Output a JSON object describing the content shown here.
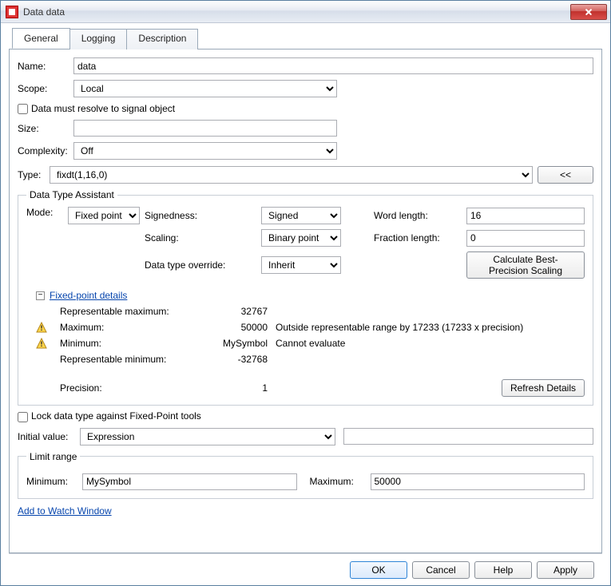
{
  "window": {
    "title": "Data data"
  },
  "tabs": {
    "t0": "General",
    "t1": "Logging",
    "t2": "Description"
  },
  "labels": {
    "name": "Name:",
    "scope": "Scope:",
    "resolve": "Data must resolve to signal object",
    "size": "Size:",
    "complexity": "Complexity:",
    "type": "Type:",
    "collapse": "<<",
    "dta": "Data Type Assistant",
    "mode": "Mode:",
    "signed": "Signedness:",
    "scaling": "Scaling:",
    "dto": "Data type override:",
    "wlen": "Word length:",
    "flen": "Fraction length:",
    "calc": "Calculate Best-Precision Scaling",
    "fpd": "Fixed-point details",
    "repmax": "Representable maximum:",
    "max": "Maximum:",
    "min": "Minimum:",
    "repmin": "Representable minimum:",
    "prec": "Precision:",
    "refresh": "Refresh Details",
    "lock": "Lock data type against Fixed-Point tools",
    "ival": "Initial value:",
    "limit": "Limit range",
    "lmin": "Minimum:",
    "lmax": "Maximum:",
    "watch": "Add to Watch Window"
  },
  "values": {
    "name": "data",
    "scope": "Local",
    "size": "",
    "complexity": "Off",
    "type": "fixdt(1,16,0)",
    "mode": "Fixed point",
    "signed": "Signed",
    "scaling": "Binary point",
    "dto": "Inherit",
    "wlen": "16",
    "flen": "0",
    "repmax": "32767",
    "max": "50000",
    "maxmsg": "Outside representable range by 17233 (17233 x precision)",
    "min": "MySymbol",
    "minmsg": "Cannot evaluate",
    "repmin": "-32768",
    "prec": "1",
    "ival": "Expression",
    "ivalv": "",
    "lmin": "MySymbol",
    "lmax": "50000"
  },
  "buttons": {
    "ok": "OK",
    "cancel": "Cancel",
    "help": "Help",
    "apply": "Apply"
  }
}
